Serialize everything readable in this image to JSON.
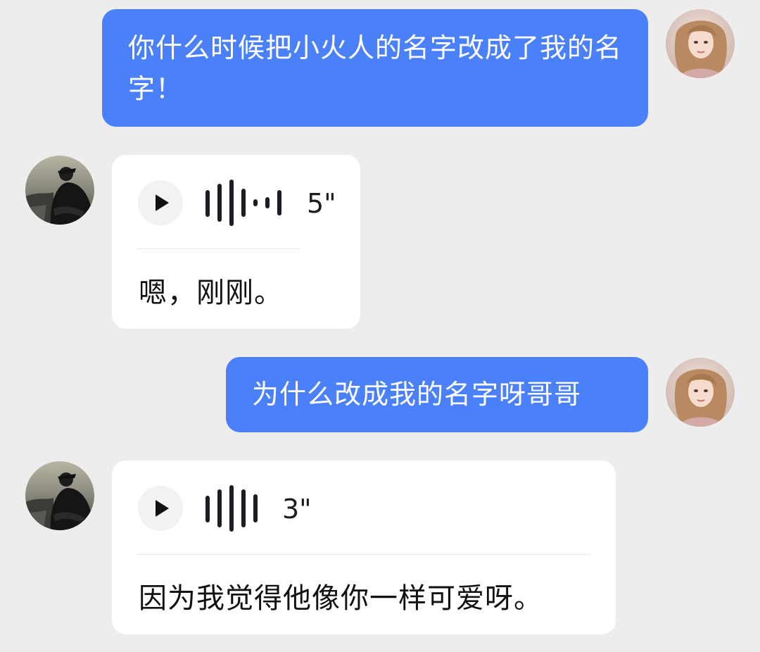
{
  "messages": [
    {
      "side": "right",
      "type": "text",
      "text": "你什么时候把小火人的名字改成了我的名字！"
    },
    {
      "side": "left",
      "type": "voice",
      "duration": "5\"",
      "transcript": "嗯，刚刚。"
    },
    {
      "side": "right",
      "type": "text",
      "text": "为什么改成我的名字呀哥哥"
    },
    {
      "side": "left",
      "type": "voice",
      "duration": "3\"",
      "transcript": "因为我觉得他像你一样可爱呀。"
    }
  ],
  "colors": {
    "background": "#ededed",
    "outgoing_bubble": "#4b80fb",
    "incoming_bubble": "#ffffff",
    "text_dark": "#111111"
  },
  "icons": {
    "play": "play-icon",
    "waveform": "waveform-icon"
  }
}
